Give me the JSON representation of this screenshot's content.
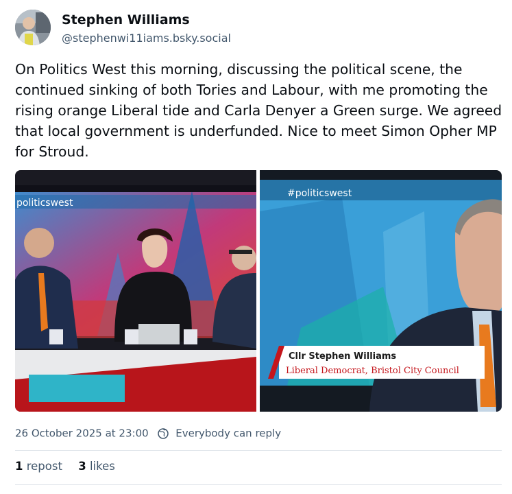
{
  "author": {
    "display_name": "Stephen Williams",
    "handle": "@stephenwi11iams.bsky.social",
    "avatar_icon": "user-avatar-photo"
  },
  "post": {
    "text": "On Politics West this morning, discussing the political scene, the continued sinking of both Tories and Labour, with me promoting the rising orange Liberal tide and Carla Denyer a Green surge. We agreed that local government is underfunded. Nice to meet Simon Opher MP for Stroud."
  },
  "images": {
    "left": {
      "hashtag": "politicswest"
    },
    "right": {
      "hashtag": "#politicswest",
      "caption_name": "Cllr Stephen Williams",
      "caption_role": "Liberal Democrat, Bristol City Council"
    }
  },
  "meta": {
    "timestamp": "26 October 2025 at 23:00",
    "reply_setting": "Everybody can reply",
    "reply_icon": "globe-icon"
  },
  "stats": {
    "reposts_count": "1",
    "reposts_label": "repost",
    "likes_count": "3",
    "likes_label": "likes"
  },
  "colors": {
    "text_primary": "#0b0f14",
    "text_secondary": "#42576c",
    "divider": "#dfe4ea",
    "studio_blue": "#2a86c8",
    "studio_red": "#d8232a",
    "caption_red": "#c4161c",
    "tie_orange": "#e87a1e"
  }
}
